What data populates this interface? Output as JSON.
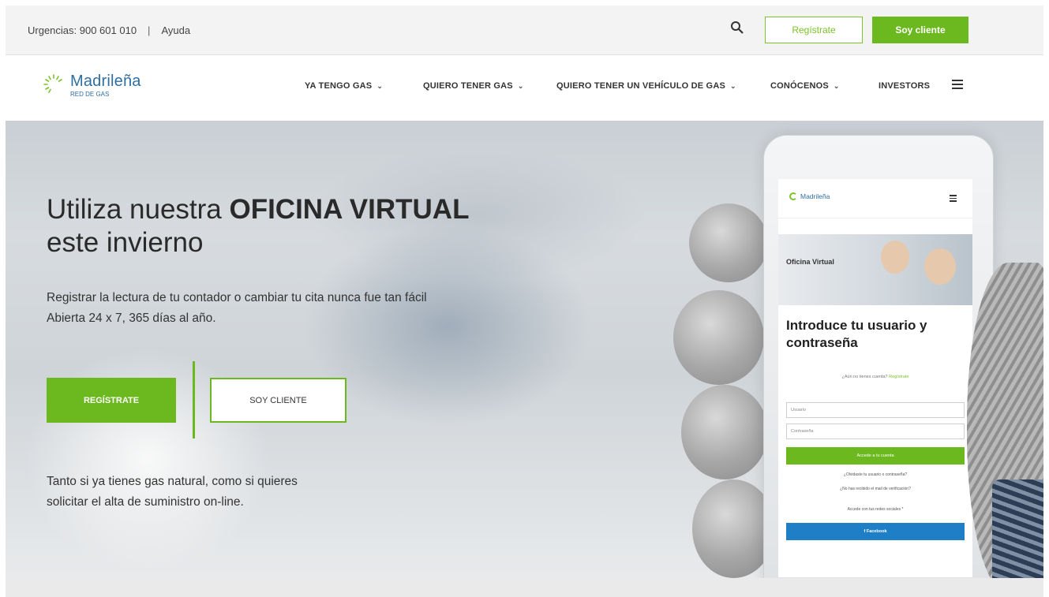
{
  "topbar": {
    "phone": "Urgencias: 900 601 010",
    "separator": "|",
    "help": "Ayuda",
    "register_label": "Regístrate",
    "client_label": "Soy cliente"
  },
  "nav": {
    "logo_name": "Madrileña",
    "logo_sub": "RED DE GAS",
    "items": [
      {
        "label": "YA TENGO GAS",
        "dropdown": true
      },
      {
        "label": "QUIERO TENER GAS",
        "dropdown": true
      },
      {
        "label": "QUIERO TENER UN VEHÍCULO DE GAS",
        "dropdown": true
      },
      {
        "label": "CONÓCENOS",
        "dropdown": true
      },
      {
        "label": "INVESTORS",
        "dropdown": false
      }
    ],
    "chevron": "⌄"
  },
  "hero": {
    "title_pre": "Utiliza nuestra ",
    "title_bold": "OFICINA VIRTUAL",
    "title_line2": "este invierno",
    "subtitle_line1": "Registrar la lectura de tu contador o cambiar tu cita nunca fue tan fácil",
    "subtitle_line2": "Abierta 24 x 7, 365 días al año.",
    "register_button": "REGÍSTRATE",
    "client_button": "SOY CLIENTE",
    "footer_line1": "Tanto si ya tienes gas natural, como si quieres",
    "footer_line2": "solicitar el alta de suministro on-line."
  },
  "phone": {
    "logo_name": "Madrileña",
    "banner_label": "Oficina Virtual",
    "title_line1": "Introduce tu usuario y",
    "title_line2": "contraseña",
    "hint": "¿Aún no tienes cuenta?",
    "hint_link": "Regístrate",
    "user_placeholder": "Usuario",
    "pass_placeholder": "Contraseña",
    "access_button": "Accede a tu cuenta",
    "link1": "¿Olvidaste tu usuario o contraseña?",
    "link2": "¿No has recibido el mail de verificación?",
    "social_text": "Accede con tus redes sociales *",
    "facebook_button": "f  Facebook"
  },
  "colors": {
    "brand_green": "#6cb91f",
    "brand_blue": "#2f6ea0",
    "facebook_blue": "#1e7fc7"
  },
  "icons": {
    "search": "search-icon",
    "menu": "hamburger-icon",
    "logo": "madrilena-logo-icon"
  }
}
